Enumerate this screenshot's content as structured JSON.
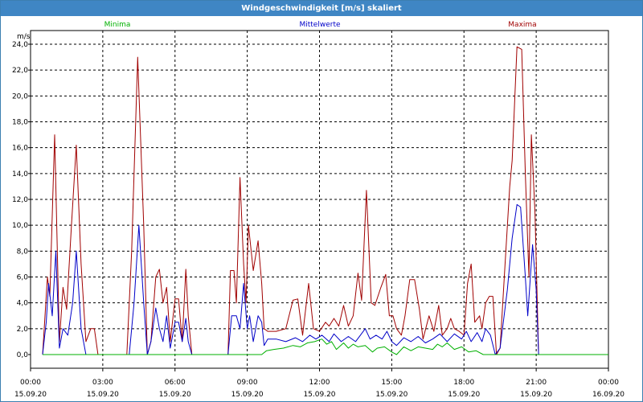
{
  "window": {
    "title": "Windgeschwindigkeit [m/s] skaliert"
  },
  "colors": {
    "minima": "#00b000",
    "mittelwerte": "#0000c8",
    "maxima": "#a00000",
    "grid": "#000000"
  },
  "chart_data": {
    "type": "line",
    "title": "Windgeschwindigkeit [m/s] skaliert",
    "ylabel": "m/s",
    "xlabel": "",
    "ylim": [
      0,
      24
    ],
    "xlim_hours": [
      0,
      24
    ],
    "yticks": [
      "0,0",
      "2,0",
      "4,0",
      "6,0",
      "8,0",
      "10,0",
      "12,0",
      "14,0",
      "16,0",
      "18,0",
      "20,0",
      "22,0",
      "24,0"
    ],
    "xticks": [
      {
        "time": "00:00",
        "date": "15.09.20"
      },
      {
        "time": "03:00",
        "date": "15.09.20"
      },
      {
        "time": "06:00",
        "date": "15.09.20"
      },
      {
        "time": "09:00",
        "date": "15.09.20"
      },
      {
        "time": "12:00",
        "date": "15.09.20"
      },
      {
        "time": "15:00",
        "date": "15.09.20"
      },
      {
        "time": "18:00",
        "date": "15.09.20"
      },
      {
        "time": "21:00",
        "date": "15.09.20"
      },
      {
        "time": "00:00",
        "date": "16.09.20"
      }
    ],
    "grid": true,
    "legend": [
      "Minima",
      "Mittelwerte",
      "Maxima"
    ],
    "series": [
      {
        "name": "Maxima",
        "points": [
          [
            0.5,
            0
          ],
          [
            0.7,
            6.0
          ],
          [
            0.8,
            4.5
          ],
          [
            1.0,
            17.0
          ],
          [
            1.2,
            1.0
          ],
          [
            1.35,
            5.2
          ],
          [
            1.5,
            3.5
          ],
          [
            1.7,
            10.0
          ],
          [
            1.9,
            16.2
          ],
          [
            2.1,
            7.0
          ],
          [
            2.3,
            1.0
          ],
          [
            2.5,
            2.0
          ],
          [
            2.65,
            2.0
          ],
          [
            2.8,
            0
          ],
          [
            3.0,
            0
          ],
          [
            4.0,
            0
          ],
          [
            4.2,
            8.0
          ],
          [
            4.45,
            23.0
          ],
          [
            4.7,
            10.0
          ],
          [
            4.85,
            0
          ],
          [
            5.0,
            1.0
          ],
          [
            5.2,
            6.0
          ],
          [
            5.35,
            6.6
          ],
          [
            5.5,
            4.0
          ],
          [
            5.65,
            5.2
          ],
          [
            5.8,
            1.0
          ],
          [
            6.0,
            4.3
          ],
          [
            6.15,
            4.3
          ],
          [
            6.3,
            1.0
          ],
          [
            6.45,
            6.6
          ],
          [
            6.55,
            3.0
          ],
          [
            6.7,
            0
          ],
          [
            7.0,
            0
          ],
          [
            8.2,
            0
          ],
          [
            8.3,
            6.5
          ],
          [
            8.45,
            6.5
          ],
          [
            8.55,
            4.0
          ],
          [
            8.7,
            13.7
          ],
          [
            8.85,
            7.0
          ],
          [
            8.95,
            4.0
          ],
          [
            9.05,
            10.0
          ],
          [
            9.25,
            6.5
          ],
          [
            9.45,
            8.8
          ],
          [
            9.6,
            5.5
          ],
          [
            9.7,
            2.0
          ],
          [
            9.85,
            1.8
          ],
          [
            10.2,
            1.8
          ],
          [
            10.6,
            2.0
          ],
          [
            10.9,
            4.2
          ],
          [
            11.1,
            4.3
          ],
          [
            11.3,
            1.5
          ],
          [
            11.55,
            5.5
          ],
          [
            11.75,
            2.0
          ],
          [
            12.0,
            1.8
          ],
          [
            12.25,
            2.5
          ],
          [
            12.4,
            2.2
          ],
          [
            12.6,
            2.8
          ],
          [
            12.8,
            2.2
          ],
          [
            13.0,
            3.8
          ],
          [
            13.2,
            2.2
          ],
          [
            13.4,
            3.0
          ],
          [
            13.6,
            6.3
          ],
          [
            13.75,
            4.2
          ],
          [
            13.95,
            12.7
          ],
          [
            14.15,
            4.0
          ],
          [
            14.3,
            3.8
          ],
          [
            14.55,
            5.2
          ],
          [
            14.75,
            6.2
          ],
          [
            14.9,
            3.0
          ],
          [
            15.05,
            3.0
          ],
          [
            15.2,
            2.0
          ],
          [
            15.4,
            1.5
          ],
          [
            15.55,
            3.0
          ],
          [
            15.75,
            5.8
          ],
          [
            15.95,
            5.8
          ],
          [
            16.15,
            3.5
          ],
          [
            16.3,
            1.2
          ],
          [
            16.55,
            3.0
          ],
          [
            16.75,
            1.8
          ],
          [
            16.95,
            3.8
          ],
          [
            17.1,
            1.5
          ],
          [
            17.3,
            2.0
          ],
          [
            17.45,
            2.8
          ],
          [
            17.6,
            2.0
          ],
          [
            17.8,
            1.8
          ],
          [
            18.0,
            1.5
          ],
          [
            18.15,
            5.5
          ],
          [
            18.3,
            7.0
          ],
          [
            18.45,
            2.5
          ],
          [
            18.65,
            3.0
          ],
          [
            18.75,
            2.0
          ],
          [
            18.9,
            4.0
          ],
          [
            19.05,
            4.5
          ],
          [
            19.2,
            4.5
          ],
          [
            19.35,
            0
          ],
          [
            19.5,
            0.5
          ],
          [
            19.7,
            6.8
          ],
          [
            19.9,
            13.0
          ],
          [
            20.0,
            15.0
          ],
          [
            20.2,
            23.8
          ],
          [
            20.4,
            23.6
          ],
          [
            20.55,
            14.0
          ],
          [
            20.7,
            6.0
          ],
          [
            20.8,
            17.0
          ],
          [
            20.95,
            11.0
          ],
          [
            21.1,
            0
          ],
          [
            21.3,
            0
          ],
          [
            24.0,
            0
          ]
        ]
      },
      {
        "name": "Mittelwerte",
        "points": [
          [
            0.5,
            0
          ],
          [
            0.65,
            2.5
          ],
          [
            0.75,
            5.5
          ],
          [
            0.9,
            3.0
          ],
          [
            1.05,
            8.0
          ],
          [
            1.2,
            0.5
          ],
          [
            1.35,
            2.0
          ],
          [
            1.55,
            1.5
          ],
          [
            1.75,
            4.0
          ],
          [
            1.9,
            8.0
          ],
          [
            2.1,
            2.0
          ],
          [
            2.3,
            0
          ],
          [
            4.1,
            0
          ],
          [
            4.3,
            4.0
          ],
          [
            4.5,
            10.0
          ],
          [
            4.7,
            4.0
          ],
          [
            4.85,
            0
          ],
          [
            5.0,
            1.0
          ],
          [
            5.2,
            3.6
          ],
          [
            5.35,
            2.0
          ],
          [
            5.5,
            1.0
          ],
          [
            5.65,
            3.0
          ],
          [
            5.8,
            0.5
          ],
          [
            6.0,
            2.5
          ],
          [
            6.15,
            2.5
          ],
          [
            6.3,
            1.0
          ],
          [
            6.45,
            2.8
          ],
          [
            6.55,
            1.0
          ],
          [
            6.7,
            0
          ],
          [
            8.2,
            0
          ],
          [
            8.35,
            3.0
          ],
          [
            8.55,
            3.0
          ],
          [
            8.7,
            2.0
          ],
          [
            8.85,
            5.5
          ],
          [
            9.0,
            2.0
          ],
          [
            9.1,
            3.0
          ],
          [
            9.25,
            1.0
          ],
          [
            9.45,
            3.0
          ],
          [
            9.6,
            2.5
          ],
          [
            9.7,
            0.7
          ],
          [
            9.85,
            1.2
          ],
          [
            10.2,
            1.2
          ],
          [
            10.6,
            1.0
          ],
          [
            11.0,
            1.3
          ],
          [
            11.3,
            1.0
          ],
          [
            11.6,
            1.5
          ],
          [
            11.85,
            1.2
          ],
          [
            12.1,
            1.5
          ],
          [
            12.4,
            1.0
          ],
          [
            12.6,
            1.6
          ],
          [
            12.9,
            1.0
          ],
          [
            13.2,
            1.4
          ],
          [
            13.5,
            1.0
          ],
          [
            13.7,
            1.5
          ],
          [
            13.9,
            2.0
          ],
          [
            14.1,
            1.2
          ],
          [
            14.35,
            1.5
          ],
          [
            14.6,
            1.2
          ],
          [
            14.8,
            1.8
          ],
          [
            15.0,
            1.0
          ],
          [
            15.2,
            0.7
          ],
          [
            15.5,
            1.3
          ],
          [
            15.8,
            1.0
          ],
          [
            16.1,
            1.4
          ],
          [
            16.4,
            0.9
          ],
          [
            16.7,
            1.2
          ],
          [
            17.0,
            1.6
          ],
          [
            17.3,
            1.0
          ],
          [
            17.6,
            1.6
          ],
          [
            17.9,
            1.2
          ],
          [
            18.1,
            1.8
          ],
          [
            18.3,
            1.0
          ],
          [
            18.55,
            1.7
          ],
          [
            18.75,
            1.0
          ],
          [
            18.9,
            2.0
          ],
          [
            19.1,
            1.5
          ],
          [
            19.3,
            0
          ],
          [
            19.5,
            0.5
          ],
          [
            19.8,
            5.0
          ],
          [
            20.0,
            9.0
          ],
          [
            20.2,
            11.6
          ],
          [
            20.35,
            11.4
          ],
          [
            20.55,
            6.0
          ],
          [
            20.65,
            3.0
          ],
          [
            20.85,
            8.5
          ],
          [
            21.0,
            5.0
          ],
          [
            21.1,
            0
          ],
          [
            24.0,
            0
          ]
        ]
      },
      {
        "name": "Minima",
        "points": [
          [
            0.5,
            0
          ],
          [
            9.6,
            0
          ],
          [
            9.8,
            0.3
          ],
          [
            10.1,
            0.4
          ],
          [
            10.5,
            0.5
          ],
          [
            10.9,
            0.7
          ],
          [
            11.2,
            0.6
          ],
          [
            11.5,
            0.9
          ],
          [
            11.8,
            1.0
          ],
          [
            12.1,
            1.2
          ],
          [
            12.3,
            0.8
          ],
          [
            12.5,
            1.0
          ],
          [
            12.7,
            0.4
          ],
          [
            13.0,
            0.9
          ],
          [
            13.2,
            0.5
          ],
          [
            13.4,
            0.8
          ],
          [
            13.6,
            0.6
          ],
          [
            13.9,
            0.7
          ],
          [
            14.2,
            0.2
          ],
          [
            14.4,
            0.5
          ],
          [
            14.7,
            0.6
          ],
          [
            15.0,
            0.2
          ],
          [
            15.2,
            0.0
          ],
          [
            15.5,
            0.6
          ],
          [
            15.8,
            0.3
          ],
          [
            16.1,
            0.6
          ],
          [
            16.4,
            0.5
          ],
          [
            16.7,
            0.4
          ],
          [
            16.9,
            0.8
          ],
          [
            17.1,
            0.6
          ],
          [
            17.3,
            0.9
          ],
          [
            17.6,
            0.4
          ],
          [
            17.9,
            0.6
          ],
          [
            18.2,
            0.2
          ],
          [
            18.5,
            0.3
          ],
          [
            18.8,
            0.0
          ],
          [
            24.0,
            0
          ]
        ]
      }
    ]
  }
}
